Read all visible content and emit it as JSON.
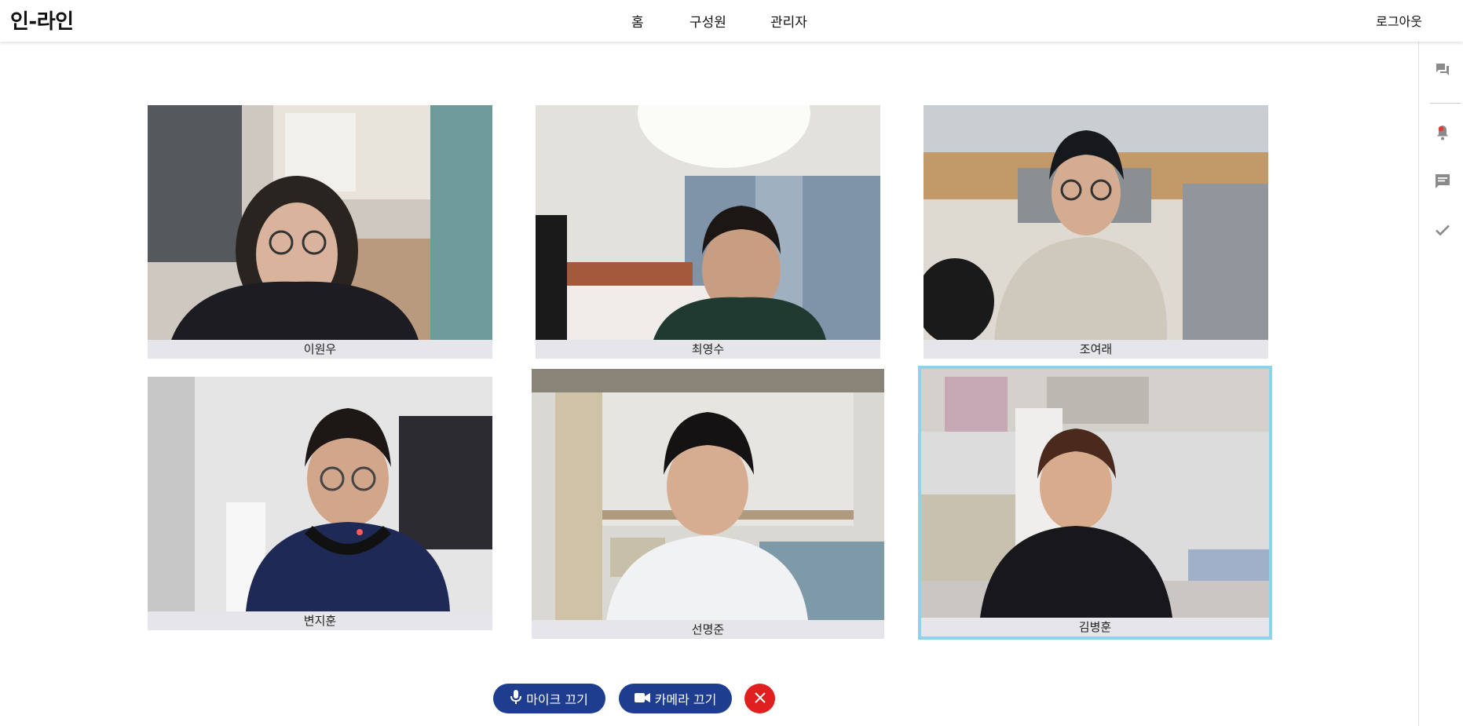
{
  "header": {
    "logo": "인-라인",
    "nav": [
      "홈",
      "구성원",
      "관리자"
    ],
    "logout": "로그아웃"
  },
  "sidebar": {
    "icons": [
      "chat-bubbles-icon",
      "notification-bell-icon",
      "message-icon",
      "check-icon"
    ],
    "notification_dot_color": "#e53935"
  },
  "participants": [
    {
      "name": "이원우"
    },
    {
      "name": "최영수"
    },
    {
      "name": "조여래"
    },
    {
      "name": "변지훈"
    },
    {
      "name": "선명준"
    },
    {
      "name": "김병훈",
      "speaking": true
    }
  ],
  "controls": {
    "mic_label": "마이크 끄기",
    "camera_label": "카메라 끄기",
    "accent": "#1e3d8f",
    "end_color": "#e02020"
  },
  "colors": {
    "speaking_border": "#8fd3ea",
    "name_bar": "#e6e6ea"
  }
}
